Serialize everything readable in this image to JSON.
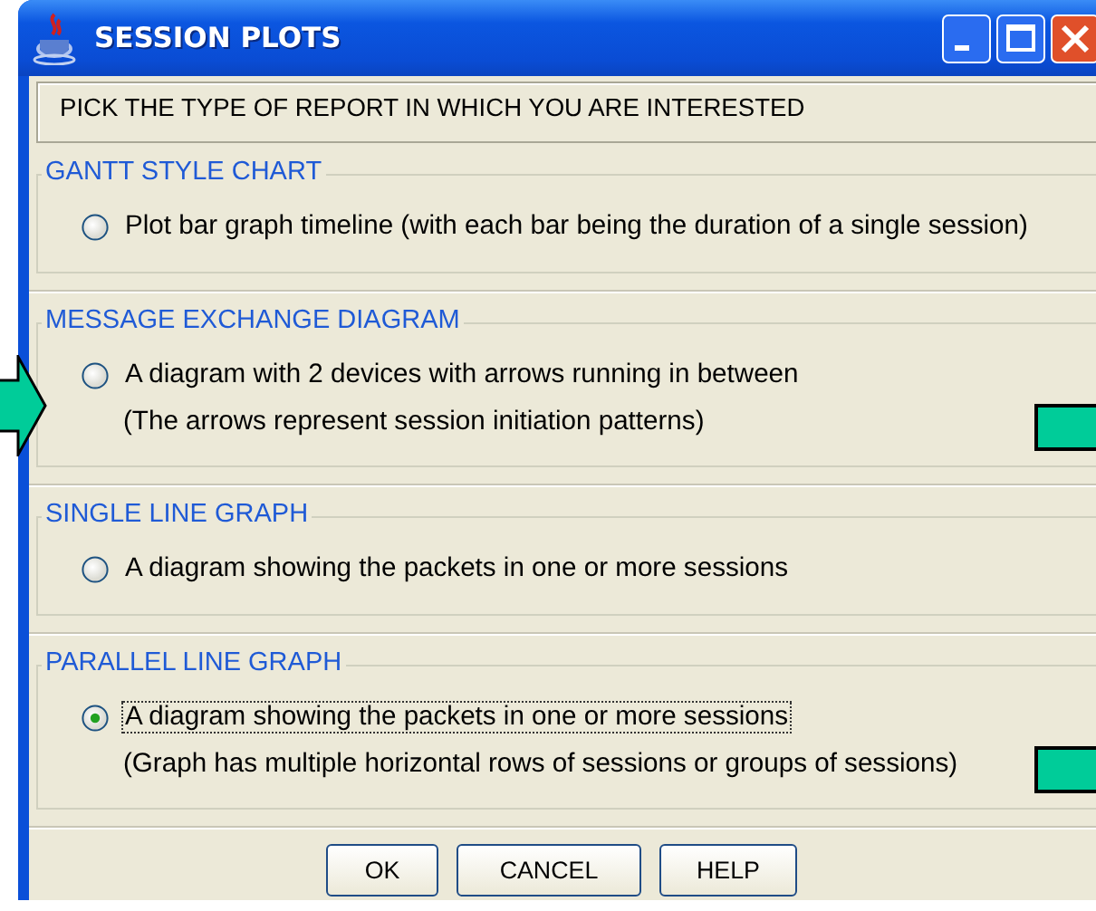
{
  "window": {
    "title": "SESSION PLOTS"
  },
  "instruction": "PICK THE TYPE OF REPORT IN WHICH YOU ARE INTERESTED",
  "groups": [
    {
      "title": "GANTT STYLE CHART",
      "label": "Plot bar graph timeline (with each bar being the duration of a single session)",
      "selected": false,
      "focused": false,
      "arrow_marker": false,
      "tab_marker": false
    },
    {
      "title": "MESSAGE EXCHANGE DIAGRAM",
      "label": "A diagram with 2 devices with arrows running in between",
      "note": "(The arrows represent session initiation patterns)",
      "selected": false,
      "focused": false,
      "arrow_marker": true,
      "tab_marker": true
    },
    {
      "title": "SINGLE LINE GRAPH",
      "label": "A diagram showing the packets in one or more sessions",
      "selected": false,
      "focused": false,
      "arrow_marker": false,
      "tab_marker": false
    },
    {
      "title": "PARALLEL LINE GRAPH",
      "label": "A diagram showing the packets in one or more sessions",
      "note": "(Graph has multiple horizontal rows of sessions or groups of sessions)",
      "selected": true,
      "focused": true,
      "arrow_marker": false,
      "tab_marker": true
    }
  ],
  "buttons": [
    "OK",
    "CANCEL",
    "HELP"
  ]
}
